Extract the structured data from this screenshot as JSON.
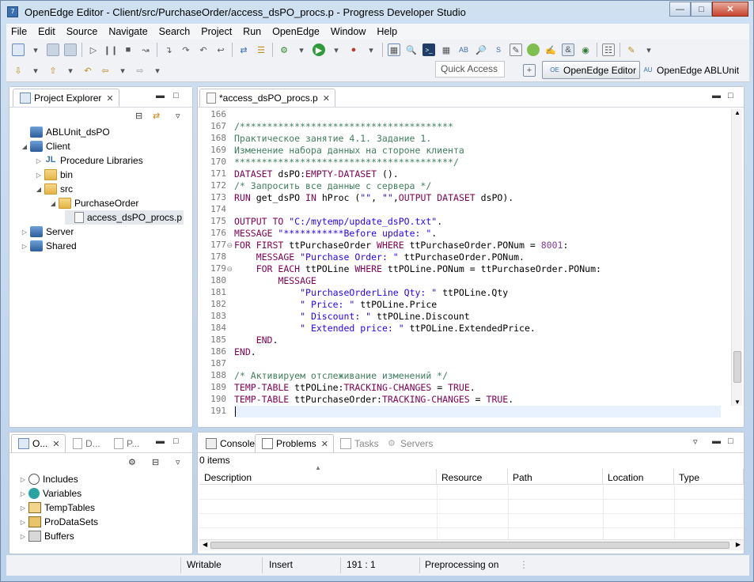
{
  "window": {
    "title": "OpenEdge Editor - Client/src/PurchaseOrder/access_dsPO_procs.p - Progress Developer Studio",
    "buttons": [
      "minimize",
      "maximize",
      "close"
    ]
  },
  "menubar": {
    "items": [
      "File",
      "Edit",
      "Source",
      "Navigate",
      "Search",
      "Project",
      "Run",
      "OpenEdge",
      "Window",
      "Help"
    ]
  },
  "toolbar": {
    "quick_access": "Quick Access",
    "perspectives": [
      {
        "label": "OpenEdge Editor",
        "active": true
      },
      {
        "label": "OpenEdge ABLUnit",
        "active": false
      }
    ]
  },
  "project_explorer": {
    "tab_label": "Project Explorer",
    "tree": [
      {
        "label": "ABLUnit_dsPO",
        "icon": "project-icon",
        "expanded": null
      },
      {
        "label": "Client",
        "icon": "project-icon",
        "expanded": true
      },
      {
        "label": "Procedure Libraries",
        "icon": "library-icon",
        "expanded": false
      },
      {
        "label": "bin",
        "icon": "folder-icon",
        "expanded": false
      },
      {
        "label": "src",
        "icon": "folder-icon",
        "expanded": true
      },
      {
        "label": "PurchaseOrder",
        "icon": "folder-icon",
        "expanded": true
      },
      {
        "label": "access_dsPO_procs.p",
        "icon": "procedure-file-icon",
        "selected": true
      },
      {
        "label": "Server",
        "icon": "project-icon",
        "expanded": false
      },
      {
        "label": "Shared",
        "icon": "project-icon",
        "expanded": false
      }
    ]
  },
  "editor": {
    "tab_label": "*access_dsPO_procs.p",
    "cursor_line": 191,
    "lines": [
      {
        "no": "166",
        "html": ""
      },
      {
        "no": "167",
        "html": "<span class='cm'>/***************************************</span>"
      },
      {
        "no": "168",
        "html": "<span class='cm'>Практическое занятие 4.1. Задание 1.</span>"
      },
      {
        "no": "169",
        "html": "<span class='cm'>Изменение набора данных на стороне клиента</span>"
      },
      {
        "no": "170",
        "html": "<span class='cm'>****************************************/</span>"
      },
      {
        "no": "171",
        "html": "<span class='kw'>DATASET</span> dsPO:<span class='kw'>EMPTY-DATASET</span> ()."
      },
      {
        "no": "172",
        "html": "<span class='cm'>/* Запросить все данные с сервера */</span>"
      },
      {
        "no": "173",
        "html": "<span class='kw'>RUN</span> get_dsPO <span class='kw'>IN</span> hProc (<span class='str'>\"\"</span>, <span class='str'>\"\"</span>,<span class='kw'>OUTPUT DATASET</span> dsPO)."
      },
      {
        "no": "174",
        "html": ""
      },
      {
        "no": "175",
        "html": "<span class='kw'>OUTPUT TO</span> <span class='str'>\"C:/mytemp/update_dsPO.txt\"</span>."
      },
      {
        "no": "176",
        "html": "<span class='kw'>MESSAGE</span> <span class='str'>\"***********Before update: \"</span>."
      },
      {
        "no": "177",
        "html": "<span class='kw'>FOR FIRST</span> ttPurchaseOrder <span class='kw'>WHERE</span> ttPurchaseOrder.PONum = <span class='num'>8001</span>:",
        "fold": true
      },
      {
        "no": "178",
        "html": "    <span class='kw'>MESSAGE</span> <span class='str'>\"Purchase Order: \"</span> ttPurchaseOrder.PONum."
      },
      {
        "no": "179",
        "html": "    <span class='kw'>FOR EACH</span> ttPOLine <span class='kw'>WHERE</span> ttPOLine.PONum = ttPurchaseOrder.PONum:",
        "fold": true
      },
      {
        "no": "180",
        "html": "        <span class='kw'>MESSAGE</span>"
      },
      {
        "no": "181",
        "html": "            <span class='str'>\"PurchaseOrderLine Qty: \"</span> ttPOLine.Qty"
      },
      {
        "no": "182",
        "html": "            <span class='str'>\" Price: \"</span> ttPOLine.Price"
      },
      {
        "no": "183",
        "html": "            <span class='str'>\" Discount: \"</span> ttPOLine.Discount"
      },
      {
        "no": "184",
        "html": "            <span class='str'>\" Extended price: \"</span> ttPOLine.ExtendedPrice."
      },
      {
        "no": "185",
        "html": "    <span class='kw'>END</span>."
      },
      {
        "no": "186",
        "html": "<span class='kw'>END</span>."
      },
      {
        "no": "187",
        "html": ""
      },
      {
        "no": "188",
        "html": "<span class='cm'>/* Активируем отслеживание изменений */</span>"
      },
      {
        "no": "189",
        "html": "<span class='kw'>TEMP-TABLE</span> ttPOLine:<span class='kw'>TRACKING-CHANGES</span> = <span class='kw'>TRUE</span>."
      },
      {
        "no": "190",
        "html": "<span class='kw'>TEMP-TABLE</span> ttPurchaseOrder:<span class='kw'>TRACKING-CHANGES</span> = <span class='kw'>TRUE</span>."
      },
      {
        "no": "191",
        "html": ""
      }
    ]
  },
  "outline": {
    "tabs": [
      "O...",
      "D...",
      "P..."
    ],
    "items": [
      "Includes",
      "Variables",
      "TempTables",
      "ProDataSets",
      "Buffers"
    ]
  },
  "bottom_panel": {
    "tabs": [
      "Console",
      "Problems",
      "Tasks",
      "Servers"
    ],
    "active_tab": "Problems",
    "item_count": "0 items",
    "columns": [
      "Description",
      "Resource",
      "Path",
      "Location",
      "Type"
    ]
  },
  "statusbar": {
    "mode": "Writable",
    "insert": "Insert",
    "position": "191 : 1",
    "status": "Preprocessing on"
  },
  "colors": {
    "keyword": "#7f0055",
    "string": "#2a00ff",
    "comment": "#3f7f5f",
    "number": "#7d3c98",
    "current_line": "#e8f2fe"
  }
}
